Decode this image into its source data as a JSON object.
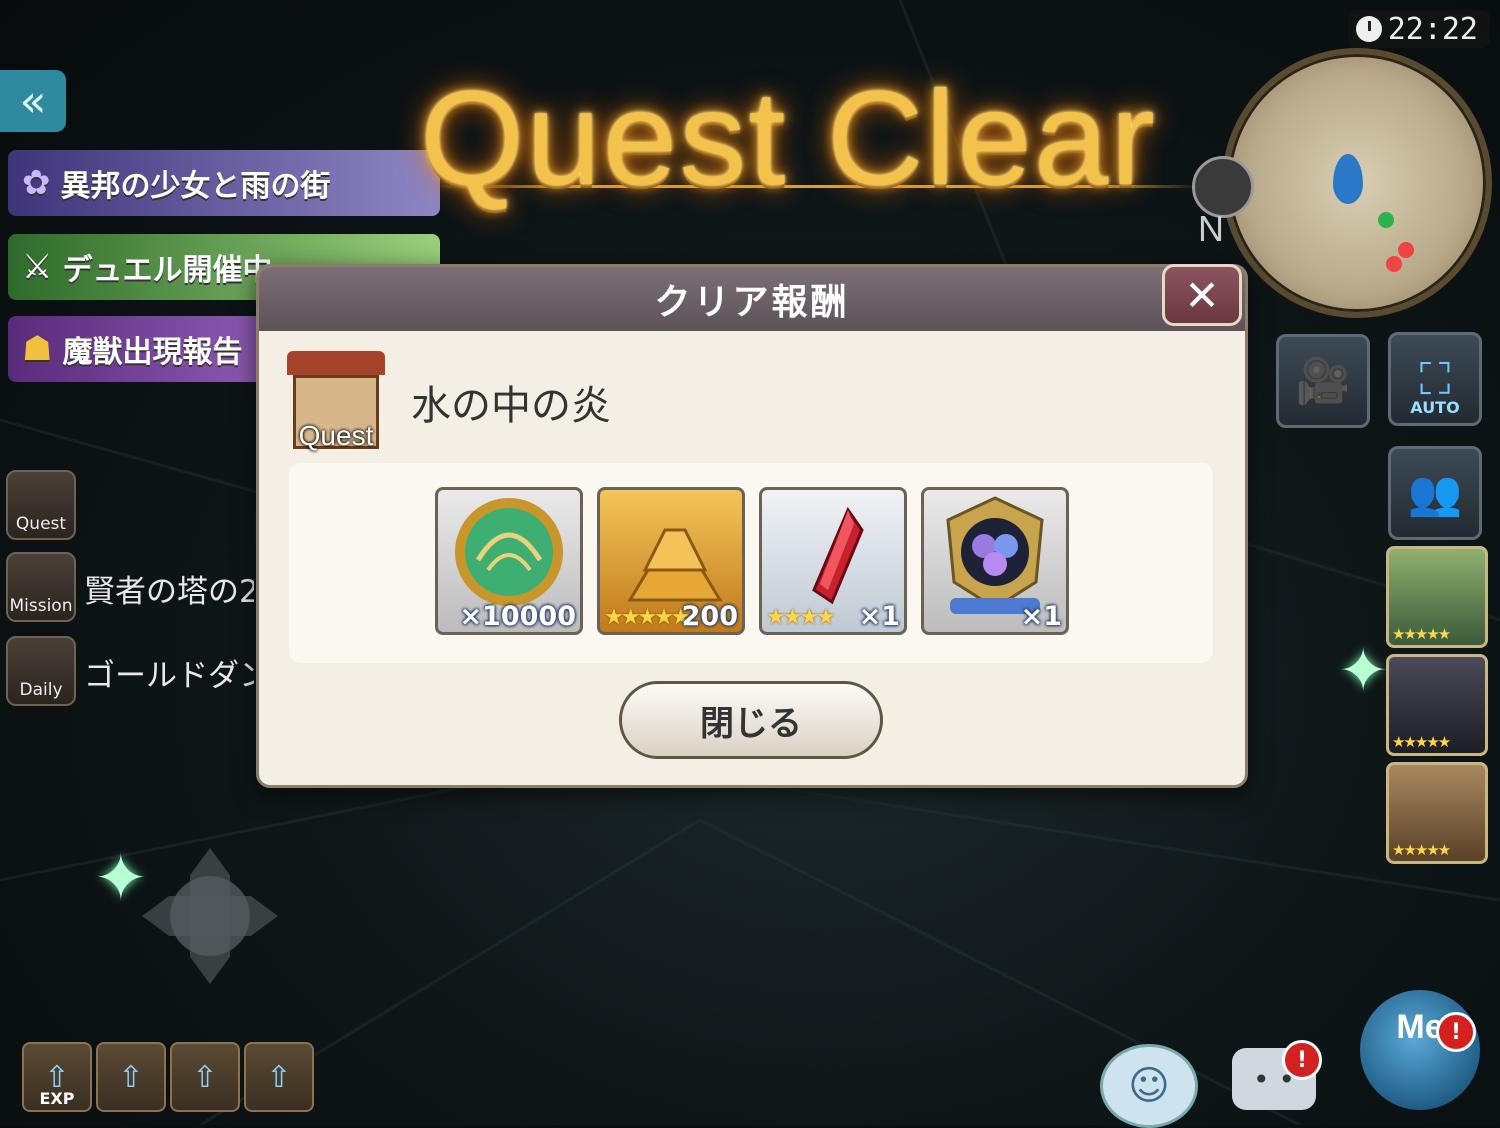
{
  "clock": "22:22",
  "title": "Quest Clear",
  "map": {
    "north_label": "N"
  },
  "left_panel": {
    "events": [
      {
        "label": "異邦の少女と雨の街",
        "color": "#5a4a9c"
      },
      {
        "label": "デュエル開催中",
        "color": "#4b8a3a"
      },
      {
        "label": "魔獣出現報告",
        "color": "#7d3a9c"
      }
    ],
    "menus": [
      {
        "icon_label": "Quest",
        "text": ""
      },
      {
        "icon_label": "Mission",
        "text": "賢者の塔の2"
      },
      {
        "icon_label": "Daily",
        "text": "ゴールドダン"
      }
    ]
  },
  "right_panel": {
    "auto_label": "AUTO",
    "portrait_stars": [
      "★★★★★",
      "★★★★★",
      "★★★★★"
    ]
  },
  "bottom_bar": {
    "exp_label": "EXP"
  },
  "chat": {
    "badge": "!"
  },
  "me": {
    "label": "Me",
    "badge": "!"
  },
  "modal": {
    "title": "クリア報酬",
    "close_icon": "✕",
    "quest_badge_label": "Quest",
    "quest_name": "水の中の炎",
    "rewards": [
      {
        "icon": "gold-coin-icon",
        "stars": "",
        "count": "×10000"
      },
      {
        "icon": "gold-bars-icon",
        "stars": "★★★★★",
        "count": "200"
      },
      {
        "icon": "red-crystal-icon",
        "stars": "★★★★",
        "count": "×1"
      },
      {
        "icon": "hydrangea-emblem-icon",
        "stars": "",
        "count": "×1"
      }
    ],
    "close_button": "閉じる"
  }
}
